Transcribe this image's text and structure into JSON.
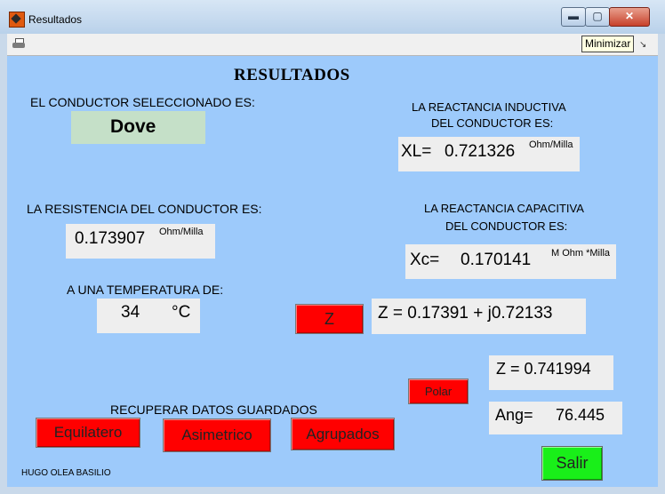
{
  "window": {
    "title": "Resultados",
    "minimize": "▬",
    "maximize": "▢",
    "close": "✕"
  },
  "toolbar": {
    "tooltip": "Minimizar",
    "print_icon": "printer-icon",
    "corner_icon": "dock-arrow-icon",
    "corner_glyph": "↘"
  },
  "colors": {
    "panel": "#9dcafb",
    "red_button": "#ff0000",
    "green_button": "#19ef19",
    "conductor_box": "#c5e0c8",
    "field_box": "#eeeeee"
  },
  "results": {
    "heading": "RESULTADOS",
    "conductor_label": "EL CONDUCTOR SELECCIONADO ES:",
    "conductor_value": "Dove",
    "resistance_label": "LA RESISTENCIA DEL CONDUCTOR ES:",
    "resistance_value": "0.173907",
    "resistance_unit": "Ohm/Milla",
    "temperature_label": "A UNA TEMPERATURA DE:",
    "temperature_value": "34",
    "temperature_unit": "°C",
    "inductive_label_1": "LA REACTANCIA INDUCTIVA",
    "inductive_label_2": "DEL CONDUCTOR ES:",
    "xl_prefix": "XL=",
    "xl_value": "0.721326",
    "xl_unit": "Ohm/Milla",
    "capacitive_label_1": "LA REACTANCIA CAPACITIVA",
    "capacitive_label_2": "DEL CONDUCTOR ES:",
    "xc_prefix": "Xc=",
    "xc_value": "0.170141",
    "xc_unit": "M Ohm *Milla",
    "z_button": "Z",
    "z_rect": "Z =   0.17391 + j0.72133",
    "polar_button": "Polar",
    "z_mag": "Z =  0.741994",
    "angle_prefix": "Ang=",
    "angle_value": "76.445",
    "recover_label": "RECUPERAR DATOS GUARDADOS",
    "btn_equilatero": "Equilatero",
    "btn_asimetrico": "Asimetrico",
    "btn_agrupados": "Agrupados",
    "author": "HUGO OLEA BASILIO",
    "btn_salir": "Salir"
  }
}
